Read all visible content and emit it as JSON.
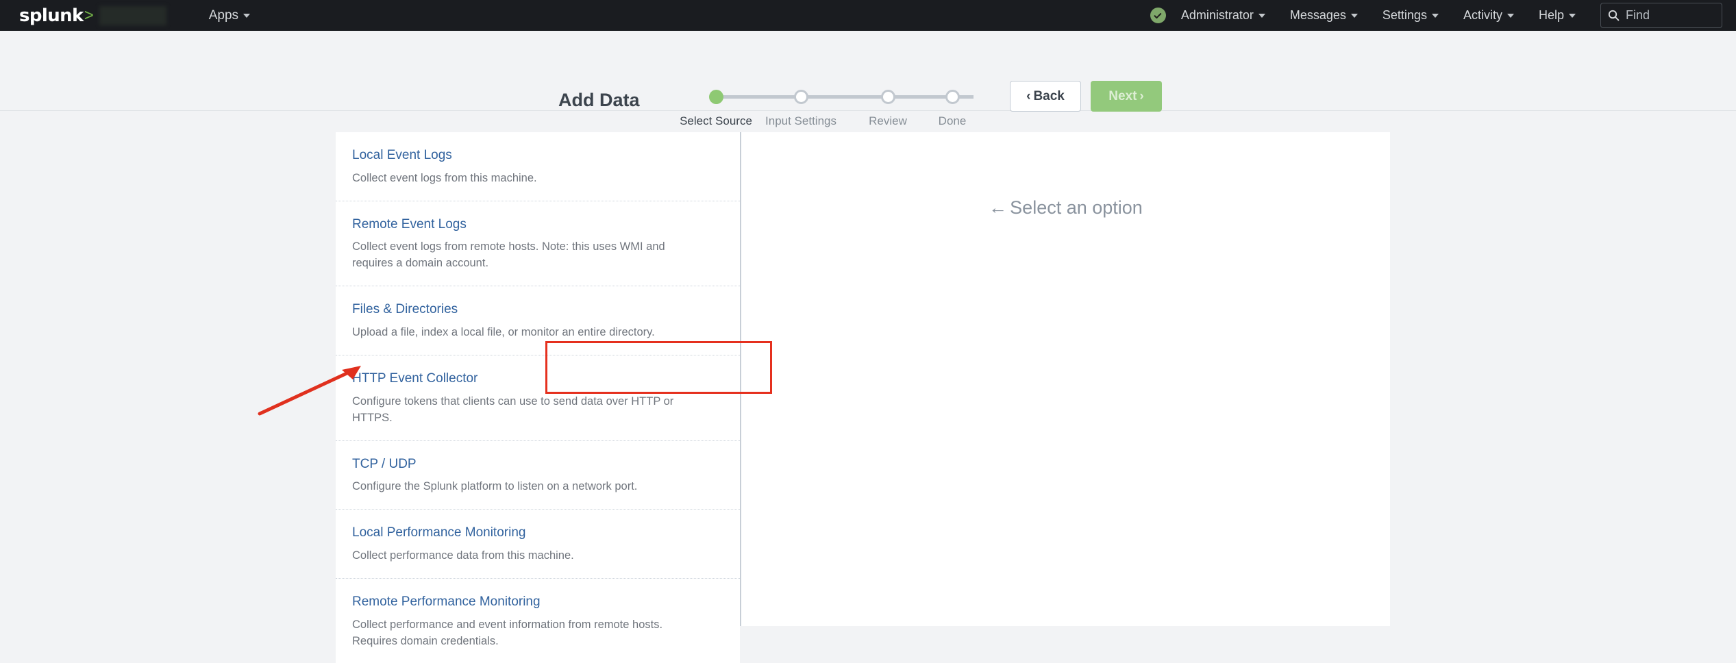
{
  "topbar": {
    "logo_word": "splunk",
    "logo_chevron": ">",
    "apps_label": "Apps",
    "status_icon": "check-circle-icon",
    "menus": [
      {
        "label": "Administrator"
      },
      {
        "label": "Messages"
      },
      {
        "label": "Settings"
      },
      {
        "label": "Activity"
      },
      {
        "label": "Help"
      }
    ],
    "find": {
      "icon": "search-icon",
      "placeholder": "Find",
      "value": "Find"
    },
    "colors": {
      "background": "#1a1c20",
      "accent_green": "#77b84a",
      "status_green": "#7fa86a"
    }
  },
  "wizard": {
    "title": "Add Data",
    "steps": [
      {
        "label": "Select Source",
        "state": "active"
      },
      {
        "label": "Input Settings",
        "state": "inactive"
      },
      {
        "label": "Review",
        "state": "inactive"
      },
      {
        "label": "Done",
        "state": "inactive"
      }
    ],
    "back_button": {
      "label": "Back",
      "chevron": "‹"
    },
    "next_button": {
      "label": "Next",
      "chevron": "›",
      "disabled": true
    },
    "colors": {
      "active_step": "#8ec973",
      "inactive_step": "#c2c8cf",
      "next_disabled": "#93c97c"
    }
  },
  "source_list": [
    {
      "title": "Local Event Logs",
      "description": "Collect event logs from this machine.",
      "highlighted": false
    },
    {
      "title": "Remote Event Logs",
      "description": "Collect event logs from remote hosts. Note: this uses WMI and requires a domain account.",
      "highlighted": false
    },
    {
      "title": "Files & Directories",
      "description": "Upload a file, index a local file, or monitor an entire directory.",
      "highlighted": false
    },
    {
      "title": "HTTP Event Collector",
      "description": "Configure tokens that clients can use to send data over HTTP or HTTPS.",
      "highlighted": true
    },
    {
      "title": "TCP / UDP",
      "description": "Configure the Splunk platform to listen on a network port.",
      "highlighted": false
    },
    {
      "title": "Local Performance Monitoring",
      "description": "Collect performance data from this machine.",
      "highlighted": false
    },
    {
      "title": "Remote Performance Monitoring",
      "description": "Collect performance and event information from remote hosts. Requires domain credentials.",
      "highlighted": false
    }
  ],
  "right_panel": {
    "arrow_glyph": "←",
    "message": "Select an option"
  },
  "annotations": {
    "highlight_color": "#e5301e",
    "arrow_color": "#e0301e",
    "target": "HTTP Event Collector"
  }
}
